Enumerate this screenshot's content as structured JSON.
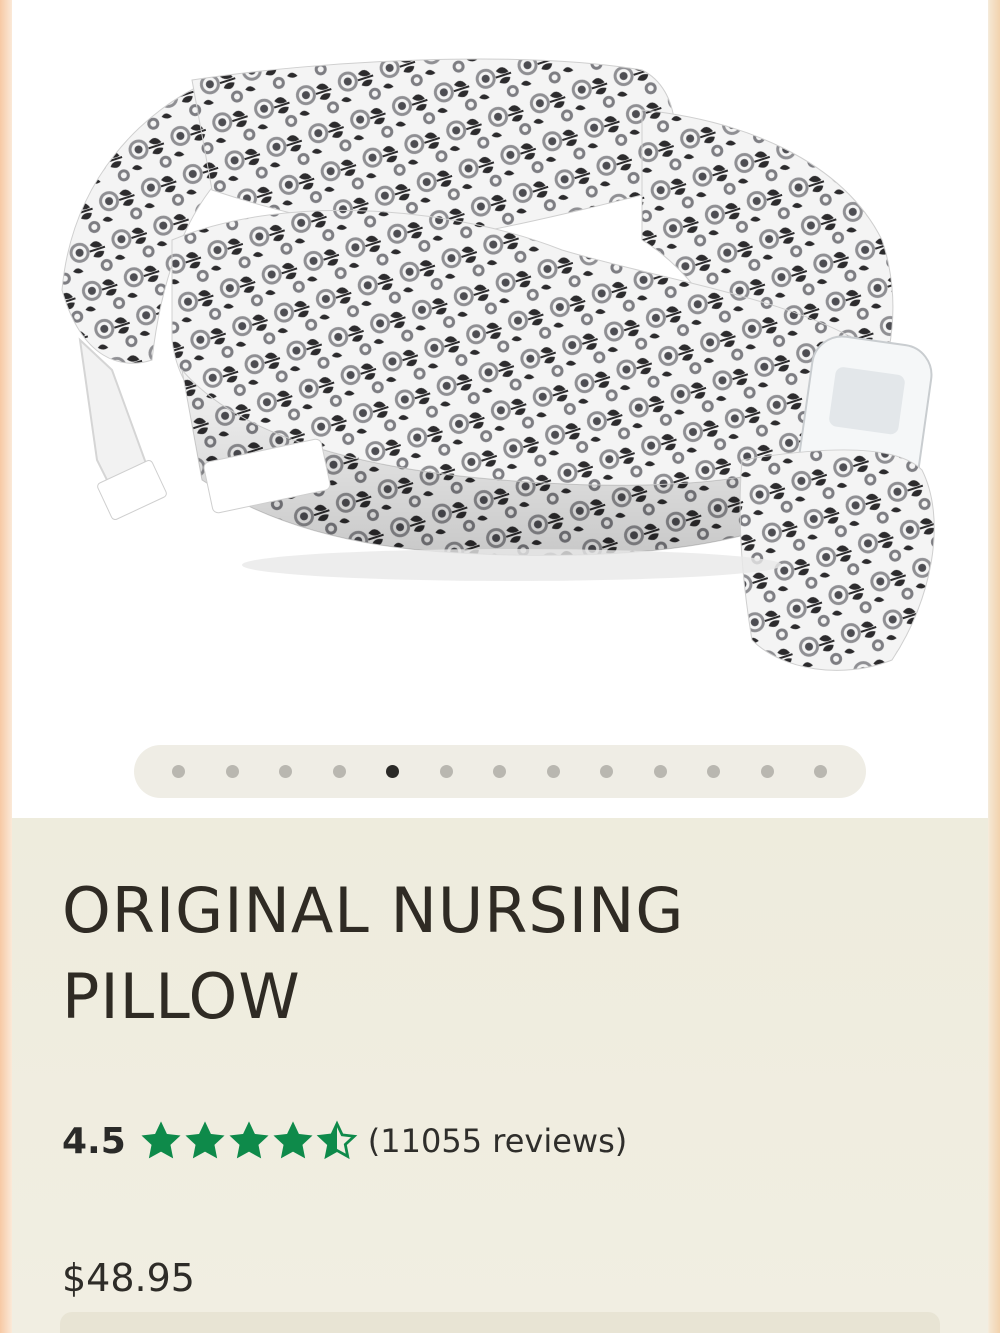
{
  "product": {
    "title": "ORIGINAL NURSING PILLOW",
    "rating": "4.5",
    "rating_value": 4.5,
    "rating_max": 5,
    "reviews": "(11055 reviews)",
    "price": "$48.95"
  },
  "gallery": {
    "image_alt": "Original Nursing Pillow in grey floral print",
    "total_images": 13,
    "active_index": 4
  },
  "colors": {
    "star": "#0e8a4a",
    "title": "#2f2b24",
    "panel_bg": "#eeecdd",
    "dot_active": "#2b2a27",
    "dot_inactive": "#b9b7b0"
  },
  "icons": {
    "star_full": "star-icon",
    "star_half": "half-star-icon"
  }
}
